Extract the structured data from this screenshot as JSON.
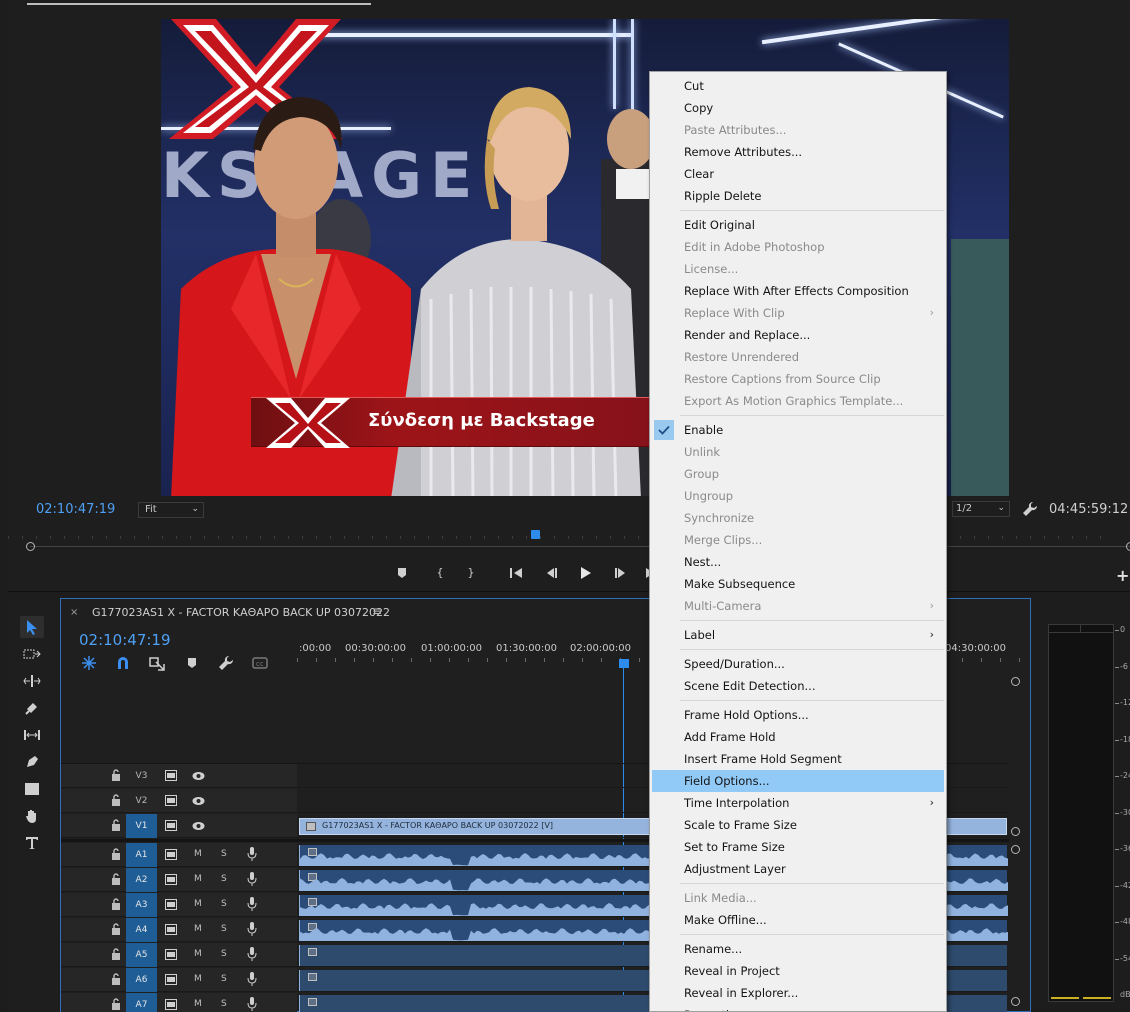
{
  "program_monitor": {
    "timecode": "02:10:47:19",
    "zoom_select": "Fit",
    "quality_select": "1/2",
    "duration": "04:45:59:12",
    "video": {
      "backstage_text": "KSTAGE",
      "lower_third_text": "Σύνδεση με Backstage"
    },
    "transport": {
      "add_marker_icon": "marker-icon",
      "mark_in_icon": "mark-in-icon",
      "mark_out_icon": "mark-out-icon",
      "go_to_in_icon": "go-to-in-icon",
      "step_back_icon": "step-back-icon",
      "play_icon": "play-icon",
      "step_forward_icon": "step-forward-icon",
      "go_to_out_icon": "go-to-out-icon"
    },
    "add_label": "+"
  },
  "timeline": {
    "close": "×",
    "sequence_title": "G177023AS1 X - FACTOR ΚΑΘΑΡΟ BACK UP 03072022",
    "menu": "≡",
    "timecode": "02:10:47:19",
    "ruler": [
      ":00:00",
      "00:30:00:00",
      "01:00:00:00",
      "01:30:00:00",
      "02:00:00:00",
      "04:30:00:00"
    ],
    "video_tracks": [
      {
        "name": "V3",
        "selected": false
      },
      {
        "name": "V2",
        "selected": false
      },
      {
        "name": "V1",
        "selected": true
      }
    ],
    "audio_tracks": [
      {
        "name": "A1",
        "m": "M",
        "s": "S",
        "has_wave": true
      },
      {
        "name": "A2",
        "m": "M",
        "s": "S",
        "has_wave": true
      },
      {
        "name": "A3",
        "m": "M",
        "s": "S",
        "has_wave": true
      },
      {
        "name": "A4",
        "m": "M",
        "s": "S",
        "has_wave": true
      },
      {
        "name": "A5",
        "m": "M",
        "s": "S",
        "has_wave": false
      },
      {
        "name": "A6",
        "m": "M",
        "s": "S",
        "has_wave": false
      },
      {
        "name": "A7",
        "m": "M",
        "s": "S",
        "has_wave": false
      }
    ],
    "video_clip_label": "G177023AS1 X - FACTOR ΚΑΘΑΡΟ BACK UP 03072022 [V]"
  },
  "audio_meter": {
    "labels": [
      "0",
      "-6",
      "-12",
      "-18",
      "-24",
      "-30",
      "-36",
      "-42",
      "-48",
      "-54",
      "dB"
    ]
  },
  "context_menu": {
    "items": [
      {
        "label": "Cut",
        "disabled": false
      },
      {
        "label": "Copy",
        "disabled": false
      },
      {
        "label": "Paste Attributes...",
        "disabled": true
      },
      {
        "label": "Remove Attributes...",
        "disabled": false
      },
      {
        "label": "Clear",
        "disabled": false
      },
      {
        "label": "Ripple Delete",
        "disabled": false
      },
      {
        "label": "Edit Original",
        "disabled": false
      },
      {
        "label": "Edit in Adobe Photoshop",
        "disabled": true
      },
      {
        "label": "License...",
        "disabled": true
      },
      {
        "label": "Replace With After Effects Composition",
        "disabled": false
      },
      {
        "label": "Replace With Clip",
        "disabled": true,
        "submenu": true
      },
      {
        "label": "Render and Replace...",
        "disabled": false
      },
      {
        "label": "Restore Unrendered",
        "disabled": true
      },
      {
        "label": "Restore Captions from Source Clip",
        "disabled": true
      },
      {
        "label": "Export As Motion Graphics Template...",
        "disabled": true
      },
      {
        "label": "Enable",
        "disabled": false,
        "checked": true
      },
      {
        "label": "Unlink",
        "disabled": true
      },
      {
        "label": "Group",
        "disabled": true
      },
      {
        "label": "Ungroup",
        "disabled": true
      },
      {
        "label": "Synchronize",
        "disabled": true
      },
      {
        "label": "Merge Clips...",
        "disabled": true
      },
      {
        "label": "Nest...",
        "disabled": false
      },
      {
        "label": "Make Subsequence",
        "disabled": false
      },
      {
        "label": "Multi-Camera",
        "disabled": true,
        "submenu": true
      },
      {
        "label": "Label",
        "disabled": false,
        "submenu": true
      },
      {
        "label": "Speed/Duration...",
        "disabled": false
      },
      {
        "label": "Scene Edit Detection...",
        "disabled": false
      },
      {
        "label": "Frame Hold Options...",
        "disabled": false
      },
      {
        "label": "Add Frame Hold",
        "disabled": false
      },
      {
        "label": "Insert Frame Hold Segment",
        "disabled": false
      },
      {
        "label": "Field Options...",
        "disabled": false,
        "highlighted": true
      },
      {
        "label": "Time Interpolation",
        "disabled": false,
        "submenu": true
      },
      {
        "label": "Scale to Frame Size",
        "disabled": false
      },
      {
        "label": "Set to Frame Size",
        "disabled": false
      },
      {
        "label": "Adjustment Layer",
        "disabled": false
      },
      {
        "label": "Link Media...",
        "disabled": true
      },
      {
        "label": "Make Offline...",
        "disabled": false
      },
      {
        "label": "Rename...",
        "disabled": false
      },
      {
        "label": "Reveal in Project",
        "disabled": false
      },
      {
        "label": "Reveal in Explorer...",
        "disabled": false
      },
      {
        "label": "Properties",
        "disabled": false
      }
    ],
    "submenu_arrow": "›",
    "check_icon": "check-icon",
    "colors": {
      "background": "#f0f0f0",
      "highlight": "#91c9f7",
      "disabled_text": "#8a8a8a"
    }
  },
  "colors": {
    "accent": "#2d8ceb",
    "timecode": "#4ea0f5",
    "track_selected": "#1e5d96",
    "clip_video": "#95b4dd",
    "clip_audio": "#2b4c78"
  }
}
